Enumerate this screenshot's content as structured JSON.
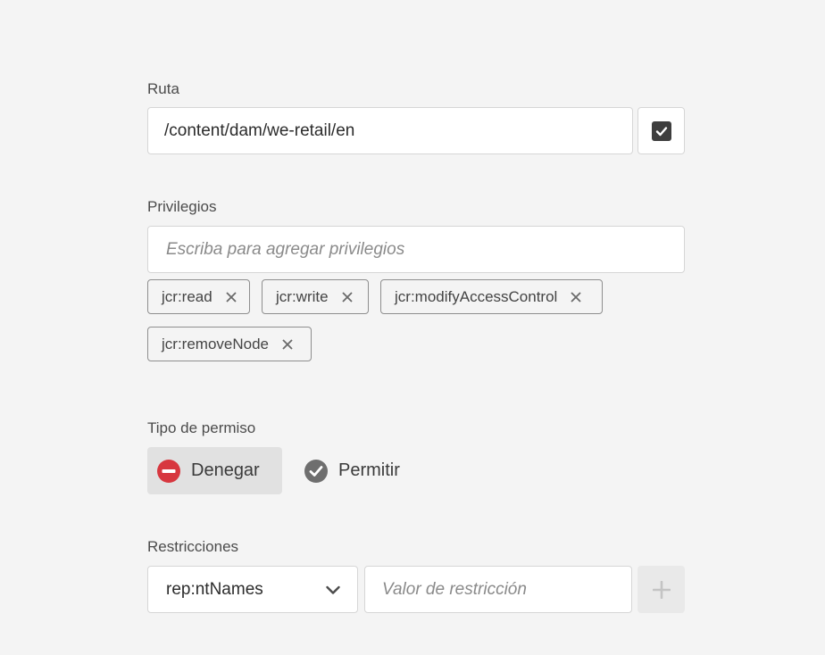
{
  "path": {
    "label": "Ruta",
    "value": "/content/dam/we-retail/en",
    "checkbox_checked": true,
    "checkbox_icon": "checkmark-icon"
  },
  "privileges": {
    "label": "Privilegios",
    "placeholder": "Escriba para agregar privilegios",
    "tags": [
      {
        "label": "jcr:read"
      },
      {
        "label": "jcr:write"
      },
      {
        "label": "jcr:modifyAccessControl"
      },
      {
        "label": "jcr:removeNode"
      }
    ],
    "remove_icon": "close-icon"
  },
  "permission_type": {
    "label": "Tipo de permiso",
    "deny_label": "Denegar",
    "allow_label": "Permitir",
    "selected": "Denegar",
    "deny_icon": "minus-circle-icon",
    "allow_icon": "check-circle-icon",
    "deny_color": "#d7373f",
    "allow_color": "#6e6e6e"
  },
  "restrictions": {
    "label": "Restricciones",
    "selected_type": "rep:ntNames",
    "value_placeholder": "Valor de restricción",
    "add_icon": "plus-icon"
  }
}
